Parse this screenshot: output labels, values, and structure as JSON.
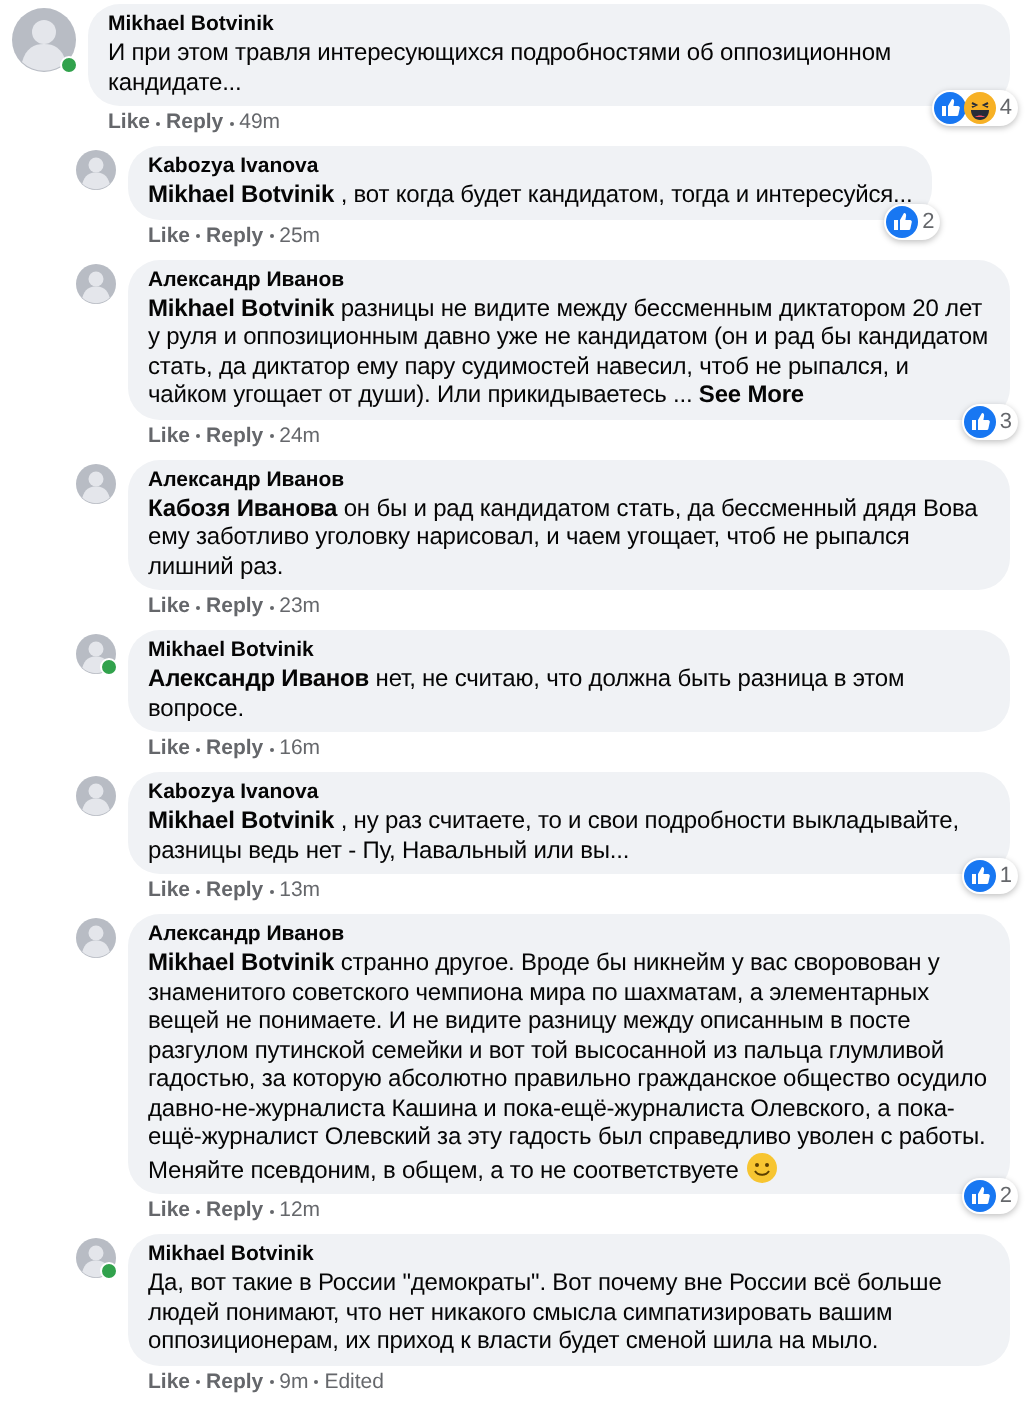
{
  "comment": {
    "author": "Mikhael Botvinik",
    "online": true,
    "text": "И при этом травля интересующихся подробностями об оппозиционном кандидате...",
    "actions": {
      "like": "Like",
      "reply": "Reply",
      "time": "49m"
    },
    "reactions": {
      "icons": [
        {
          "kind": "like"
        },
        {
          "kind": "haha"
        }
      ],
      "count": "4"
    },
    "children": [
      {
        "author": "Kabozya Ivanova",
        "online": false,
        "mention": "Mikhael Botvinik",
        "text": " , вот когда будет кандидатом, тогда и интересуйся...",
        "actions": {
          "like": "Like",
          "reply": "Reply",
          "time": "25m"
        },
        "reactions": {
          "icons": [
            {
              "kind": "like"
            }
          ],
          "count": "2"
        }
      },
      {
        "author": "Александр Иванов",
        "online": false,
        "mention": "Mikhael Botvinik",
        "text": " разницы не видите между бессменным диктатором 20 лет у руля и оппозиционным давно уже не кандидатом (он и рад бы кандидатом стать, да диктатор ему пару судимостей навесил, чтоб не рыпался, и чайком угощает от души). Или прикидываетесь ...",
        "see_more": "See More",
        "actions": {
          "like": "Like",
          "reply": "Reply",
          "time": "24m"
        },
        "reactions": {
          "icons": [
            {
              "kind": "like"
            }
          ],
          "count": "3"
        }
      },
      {
        "author": "Александр Иванов",
        "online": false,
        "mention": "Кабозя Иванова",
        "text": " он бы и рад кандидатом стать, да бессменный дядя Вова ему заботливо уголовку нарисовал, и чаем угощает, чтоб не рыпался лишний раз.",
        "actions": {
          "like": "Like",
          "reply": "Reply",
          "time": "23m"
        }
      },
      {
        "author": "Mikhael Botvinik",
        "online": true,
        "mention": "Александр Иванов",
        "text": " нет, не считаю, что должна быть разница в этом вопросе.",
        "actions": {
          "like": "Like",
          "reply": "Reply",
          "time": "16m"
        }
      },
      {
        "author": "Kabozya Ivanova",
        "online": false,
        "mention": "Mikhael Botvinik",
        "text": " , ну раз считаете, то и свои подробности выкладывайте, разницы ведь нет - Пу, Навальный или вы...",
        "actions": {
          "like": "Like",
          "reply": "Reply",
          "time": "13m"
        },
        "reactions": {
          "icons": [
            {
              "kind": "like"
            }
          ],
          "count": "1"
        }
      },
      {
        "author": "Александр Иванов",
        "online": false,
        "mention": "Mikhael Botvinik",
        "text": " странно другое. Вроде бы никнейм у вас своровован у знаменитого советского чемпиона мира по шахматам, а элементарных вещей не понимаете. И не видите разницу между описанным в посте разгулом путинской семейки и вот той высосанной из пальца глумливой гадостью, за которую абсолютно правильно гражданское общество осудило давно-не-журналиста Кашина и пока-ещё-журналиста Олевского, а пока-ещё-журналист Олевский за эту гадость был справедливо уволен с работы. Меняйте псевдоним, в общем, а то не соответствуете ",
        "emoji": {
          "kind": "smile"
        },
        "actions": {
          "like": "Like",
          "reply": "Reply",
          "time": "12m"
        },
        "reactions": {
          "icons": [
            {
              "kind": "like"
            }
          ],
          "count": "2"
        }
      },
      {
        "author": "Mikhael Botvinik",
        "online": true,
        "text": "Да, вот такие в России \"демократы\". Вот почему вне России всё больше людей понимают, что нет никакого смысла симпатизировать вашим оппозиционерам, их приход к власти будет сменой шила на мыло.",
        "actions": {
          "like": "Like",
          "reply": "Reply",
          "time": "9m",
          "edited": "Edited"
        }
      }
    ]
  }
}
